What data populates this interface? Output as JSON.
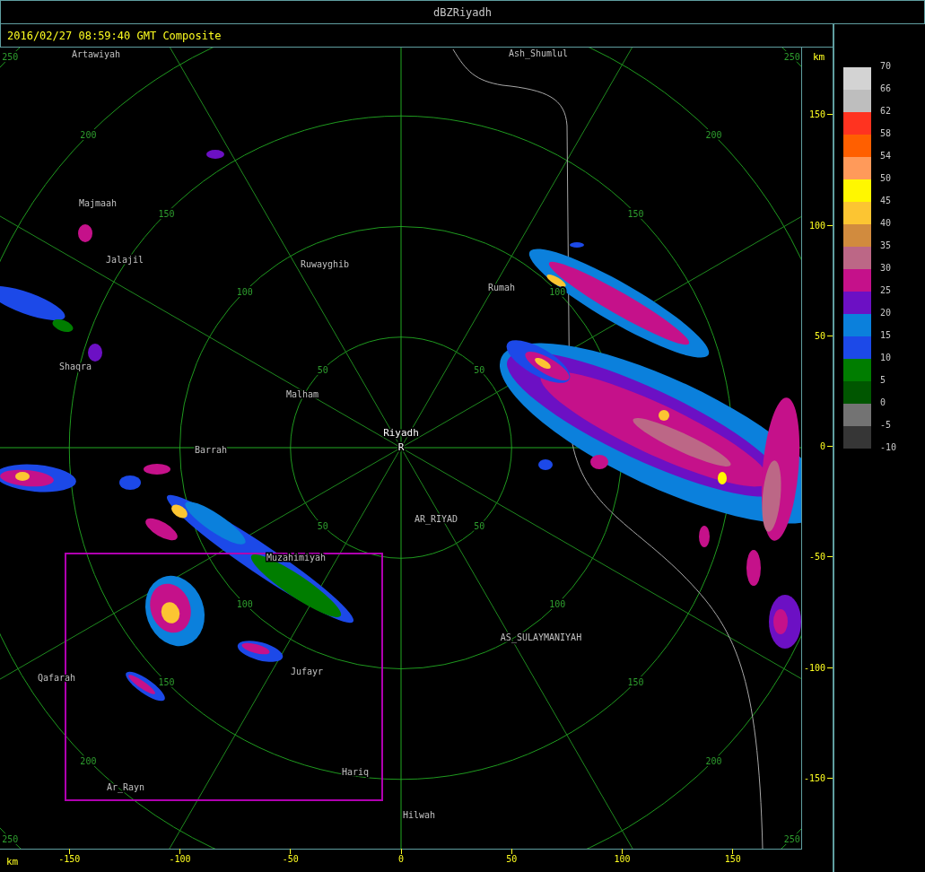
{
  "window": {
    "title": "dBZRiyadh"
  },
  "header": {
    "timestamp": "2016/02/27 08:59:40 GMT Composite"
  },
  "ring_labels": [
    "50",
    "50",
    "50",
    "50",
    "100",
    "100",
    "100",
    "100",
    "150",
    "150",
    "150",
    "150",
    "200",
    "200",
    "200",
    "200",
    "250",
    "250",
    "250",
    "250"
  ],
  "places": [
    {
      "name": "Artawiyah",
      "kind": "place"
    },
    {
      "name": "Ash_Shumlul",
      "kind": "place"
    },
    {
      "name": "Majmaah",
      "kind": "place"
    },
    {
      "name": "Jalajil",
      "kind": "place"
    },
    {
      "name": "Ruwayghib",
      "kind": "place"
    },
    {
      "name": "Rumah",
      "kind": "place"
    },
    {
      "name": "Shaqra",
      "kind": "place"
    },
    {
      "name": "Malham",
      "kind": "place"
    },
    {
      "name": "Riyadh",
      "kind": "radar"
    },
    {
      "name": "R",
      "kind": "radar"
    },
    {
      "name": "Barrah",
      "kind": "place"
    },
    {
      "name": "AR_RIYAD",
      "kind": "place"
    },
    {
      "name": "Muzahimiyah",
      "kind": "place"
    },
    {
      "name": "AS_SULAYMANIYAH",
      "kind": "place"
    },
    {
      "name": "Qafarah",
      "kind": "place"
    },
    {
      "name": "Jufayr",
      "kind": "place"
    },
    {
      "name": "Hariq",
      "kind": "place"
    },
    {
      "name": "Ar_Rayn",
      "kind": "place"
    },
    {
      "name": "Hilwah",
      "kind": "place"
    }
  ],
  "y_axis": {
    "unit": "km",
    "ticks": [
      "150",
      "100",
      "50",
      "0",
      "-50",
      "-100",
      "-150"
    ]
  },
  "x_axis": {
    "unit": "km",
    "ticks": [
      "-150",
      "-100",
      "-50",
      "0",
      "50",
      "100",
      "150"
    ]
  },
  "legend": [
    {
      "label": "70",
      "color": "#d3d3d3"
    },
    {
      "label": "66",
      "color": "#bebebe"
    },
    {
      "label": "62",
      "color": "#ff3320"
    },
    {
      "label": "58",
      "color": "#ff5f00"
    },
    {
      "label": "54",
      "color": "#ff9a5a"
    },
    {
      "label": "50",
      "color": "#fff700"
    },
    {
      "label": "45",
      "color": "#fcc532"
    },
    {
      "label": "40",
      "color": "#d18b3e"
    },
    {
      "label": "35",
      "color": "#bc6786"
    },
    {
      "label": "30",
      "color": "#c5118a"
    },
    {
      "label": "25",
      "color": "#6c10c4"
    },
    {
      "label": "20",
      "color": "#0b80dc"
    },
    {
      "label": "15",
      "color": "#1c49e8"
    },
    {
      "label": "10",
      "color": "#007d00"
    },
    {
      "label": "5",
      "color": "#005600"
    },
    {
      "label": "0",
      "color": "#737373"
    },
    {
      "label": "-5",
      "color": "#363636"
    },
    {
      "label": "-10"
    }
  ]
}
